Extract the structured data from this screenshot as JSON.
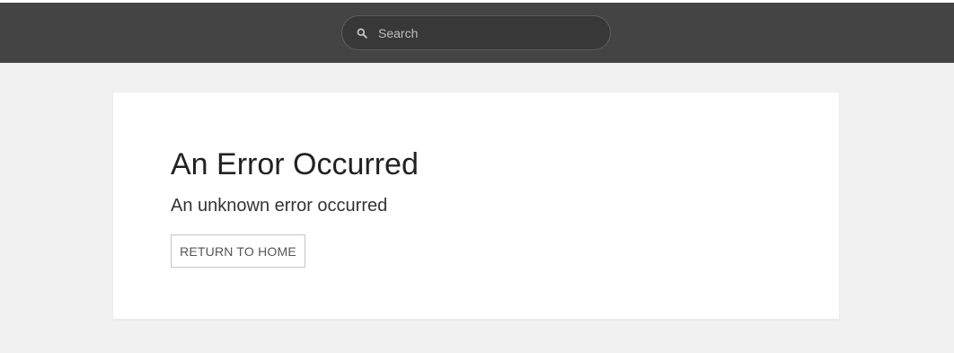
{
  "header": {
    "search": {
      "placeholder": "Search",
      "value": "",
      "icon": "search-icon"
    },
    "background_color": "#444444"
  },
  "error_card": {
    "title": "An Error Occurred",
    "message": "An unknown error occurred",
    "return_button_label": "RETURN TO HOME"
  }
}
